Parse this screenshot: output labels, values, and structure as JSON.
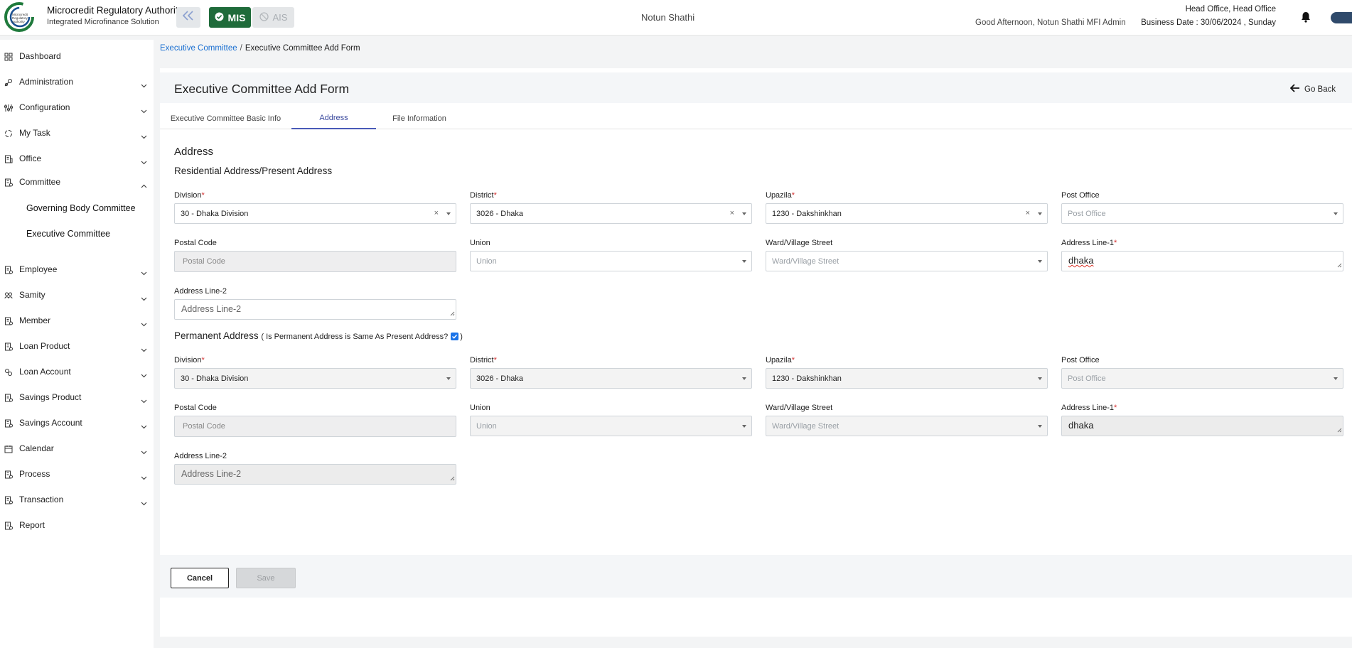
{
  "header": {
    "org_name": "Microcredit Regulatory Authority",
    "org_sub": "Integrated Microfinance Solution",
    "logo_text": "Microcredit Regulatory Authority",
    "mis_label": "MIS",
    "ais_label": "AIS",
    "center_title": "Notun Shathi",
    "greeting": "Good Afternoon, Notun Shathi MFI Admin",
    "office": "Head Office, Head Office",
    "business_date": "Business Date : 30/06/2024 , Sunday"
  },
  "sidebar": {
    "items": [
      {
        "label": "Dashboard",
        "icon": "dashboard-icon"
      },
      {
        "label": "Administration",
        "icon": "administration-icon"
      },
      {
        "label": "Configuration",
        "icon": "configuration-icon"
      },
      {
        "label": "My Task",
        "icon": "task-icon"
      },
      {
        "label": "Office",
        "icon": "office-icon"
      },
      {
        "label": "Committee",
        "icon": "committee-icon"
      },
      {
        "label": "Employee",
        "icon": "employee-icon"
      },
      {
        "label": "Samity",
        "icon": "samity-icon"
      },
      {
        "label": "Member",
        "icon": "member-icon"
      },
      {
        "label": "Loan Product",
        "icon": "loan-product-icon"
      },
      {
        "label": "Loan Account",
        "icon": "loan-account-icon"
      },
      {
        "label": "Savings Product",
        "icon": "savings-product-icon"
      },
      {
        "label": "Savings Account",
        "icon": "savings-account-icon"
      },
      {
        "label": "Calendar",
        "icon": "calendar-icon"
      },
      {
        "label": "Process",
        "icon": "process-icon"
      },
      {
        "label": "Transaction",
        "icon": "transaction-icon"
      },
      {
        "label": "Report",
        "icon": "report-icon"
      }
    ],
    "committee_sub": [
      "Governing Body Committee",
      "Executive Committee"
    ]
  },
  "breadcrumb": {
    "parent": "Executive Committee",
    "sep": "/",
    "current": "Executive Committee Add Form"
  },
  "page": {
    "title": "Executive Committee Add Form",
    "go_back": "Go Back"
  },
  "tabs": [
    {
      "label": "Executive Committee Basic Info",
      "active": false
    },
    {
      "label": "Address",
      "active": true
    },
    {
      "label": "File Information",
      "active": false
    }
  ],
  "form": {
    "section_title": "Address",
    "present_title": "Residential Address/Present Address",
    "permanent_title": "Permanent Address",
    "same_as_present": "( Is Permanent Address is Same As Present Address?",
    "same_as_present_close": ")",
    "same_as_present_checked": true,
    "labels": {
      "division": "Division",
      "district": "District",
      "upazila": "Upazila",
      "post_office": "Post Office",
      "postal_code": "Postal Code",
      "union": "Union",
      "ward": "Ward/Village Street",
      "address1": "Address Line-1",
      "address2": "Address Line-2",
      "required_mark": "*"
    },
    "present": {
      "division": "30 - Dhaka Division",
      "district": "3026 - Dhaka",
      "upazila": "1230 - Dakshinkhan",
      "post_office_placeholder": "Post Office",
      "postal_code_placeholder": "Postal Code",
      "union_placeholder": "Union",
      "ward_placeholder": "Ward/Village Street",
      "address1": "dhaka",
      "address2_placeholder": "Address Line-2"
    },
    "permanent": {
      "division": "30 - Dhaka Division",
      "district": "3026 - Dhaka",
      "upazila": "1230 - Dakshinkhan",
      "post_office_placeholder": "Post Office",
      "postal_code_placeholder": "Postal Code",
      "union_placeholder": "Union",
      "ward_placeholder": "Ward/Village Street",
      "address1": "dhaka",
      "address2_placeholder": "Address Line-2"
    },
    "clear_glyph": "×"
  },
  "actions": {
    "cancel": "Cancel",
    "save": "Save"
  },
  "colors": {
    "mis_green": "#1f6b3a",
    "link_blue": "#1a6fd1",
    "tab_active": "#4a5bb8",
    "required_red": "#d32f2f"
  }
}
